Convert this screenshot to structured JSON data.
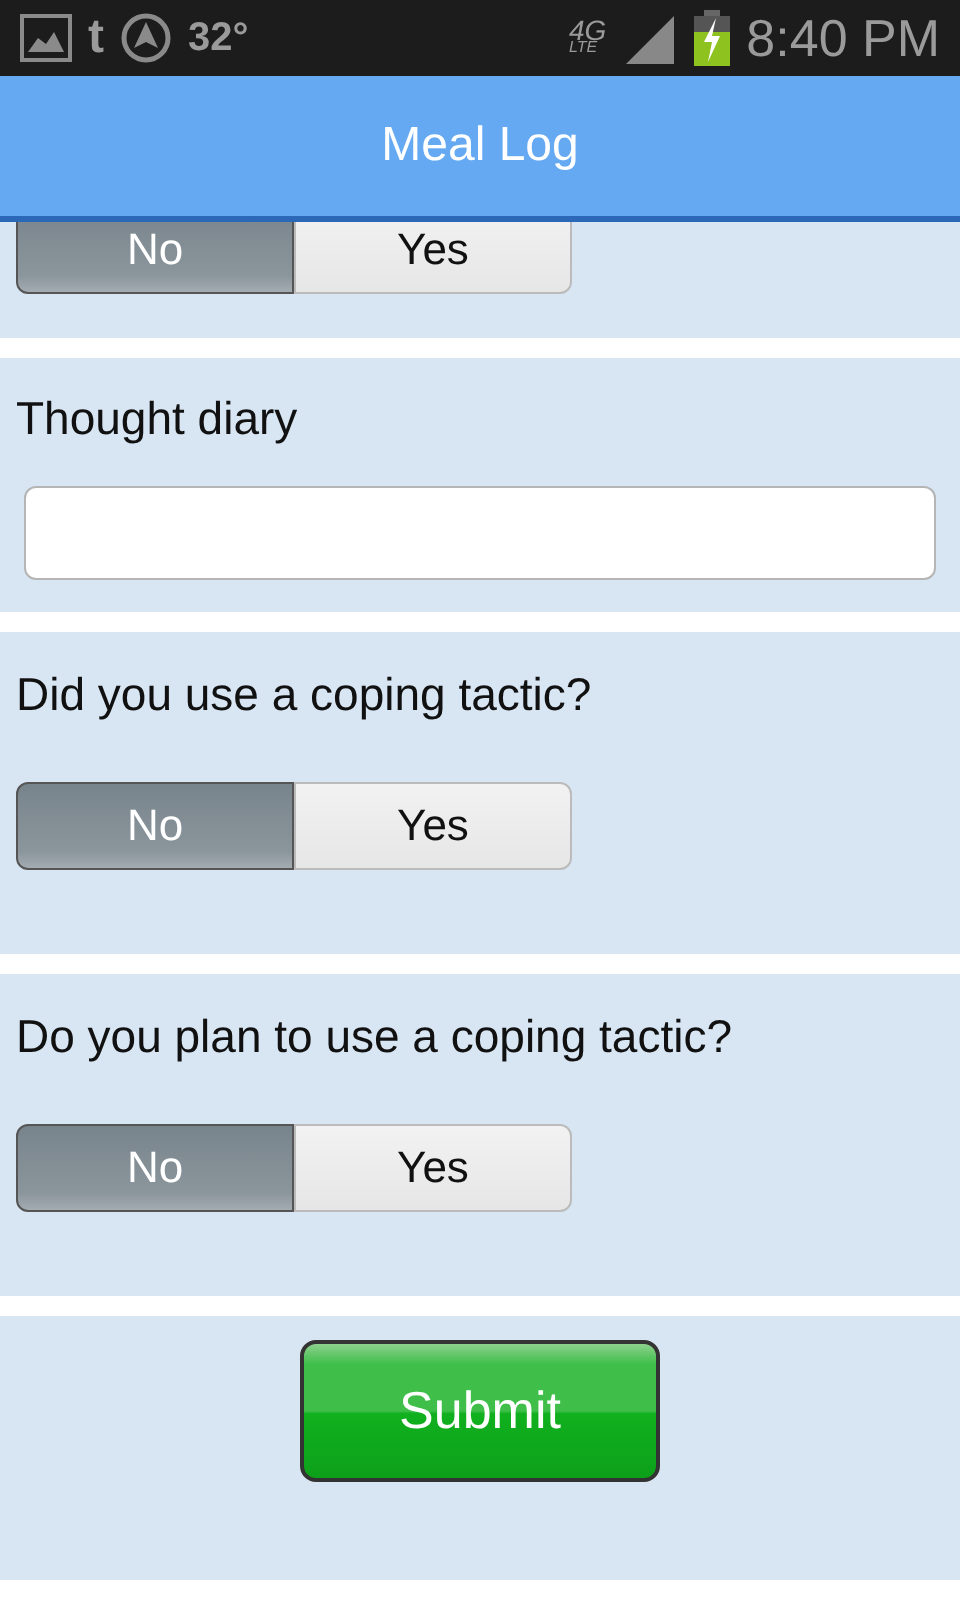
{
  "status_bar": {
    "app_letter": "t",
    "temperature": "32°",
    "network": "4G",
    "network_sub": "LTE",
    "time": "8:40 PM"
  },
  "header": {
    "title": "Meal Log"
  },
  "sections": [
    {
      "kind": "toggle",
      "options": [
        {
          "label": "No",
          "selected": true
        },
        {
          "label": "Yes",
          "selected": false
        }
      ]
    },
    {
      "kind": "textarea",
      "label": "Thought diary"
    },
    {
      "kind": "toggle",
      "label": "Did you use a coping tactic?",
      "options": [
        {
          "label": "No",
          "selected": true
        },
        {
          "label": "Yes",
          "selected": false
        }
      ]
    },
    {
      "kind": "toggle",
      "label": "Do you plan to use a coping tactic?",
      "options": [
        {
          "label": "No",
          "selected": true
        },
        {
          "label": "Yes",
          "selected": false
        }
      ]
    },
    {
      "kind": "submit",
      "label": "Submit"
    }
  ]
}
